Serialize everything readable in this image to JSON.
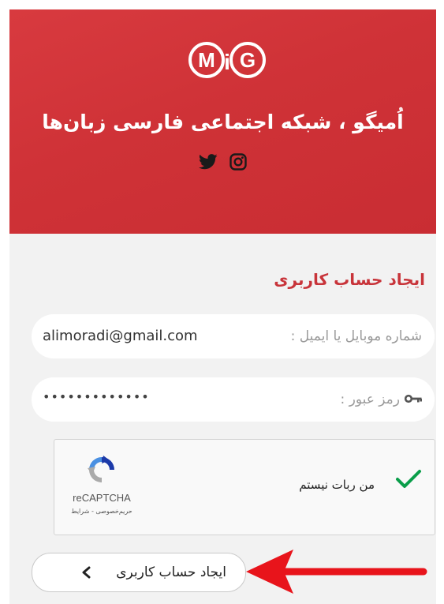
{
  "header": {
    "logo_text": "MiG",
    "site_title": "اُمیگو ، شبکه اجتماعی فارسی زبان‌ها",
    "social": [
      "twitter-icon",
      "instagram-icon"
    ]
  },
  "form": {
    "title": "ایجاد حساب کاربری",
    "email": {
      "label": "شماره موبایل یا ایمیل :",
      "value": "alimoradi@gmail.com"
    },
    "password": {
      "label": "رمز عبور :",
      "value": "•••••••••••••"
    },
    "captcha": {
      "label": "من ربات نیستم",
      "brand": "reCAPTCHA",
      "links": "حریم‌خصوصی - شرایط",
      "checked": true
    },
    "submit_label": "ایجاد حساب کاربری"
  },
  "colors": {
    "brand_red": "#d0343a",
    "check_green": "#0a9e4a",
    "arrow_red": "#e8141b"
  }
}
